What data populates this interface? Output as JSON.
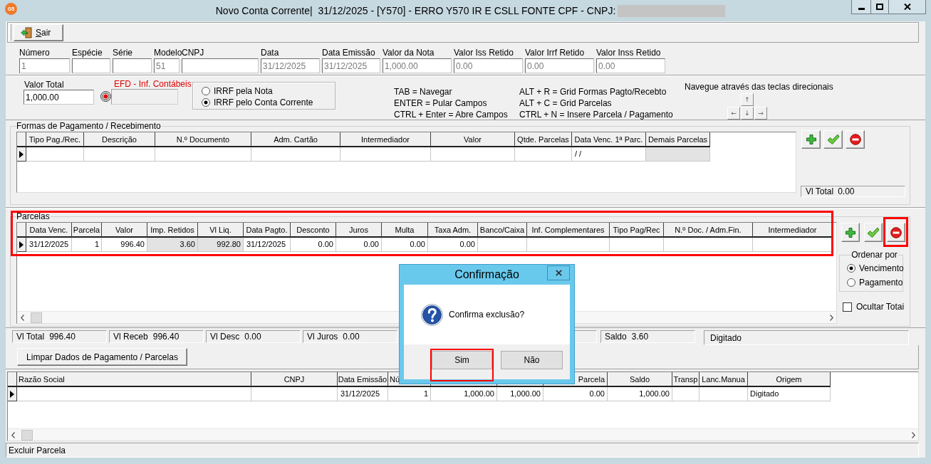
{
  "window": {
    "icon_label": "G5",
    "title": "Novo Conta Corrente|  31/12/2025 - [Y570] - ERRO Y570 IR E CSLL FONTE CPF - CNPJ:",
    "title_redacted": true
  },
  "toolbar": {
    "buttons": [
      {
        "label": "Sair"
      }
    ]
  },
  "header_fields": [
    {
      "label": "Número",
      "value": "1",
      "disabled": true
    },
    {
      "label": "Espécie"
    },
    {
      "label": "Série"
    },
    {
      "label": "Modelo",
      "value": "51",
      "disabled": true
    },
    {
      "label": "CNPJ"
    },
    {
      "label": "Data",
      "value": "31/12/2025",
      "disabled": true
    },
    {
      "label": "Data Emissão",
      "value": "31/12/2025",
      "disabled": true
    },
    {
      "label": "Valor da Nota",
      "value": "1,000.00",
      "disabled": true
    },
    {
      "label": "Valor Iss Retido",
      "value": "0.00",
      "disabled": true
    },
    {
      "label": "Valor Irrf Retido",
      "value": "0.00",
      "disabled": true
    },
    {
      "label": "Valor Inss Retido",
      "value": "0.00",
      "disabled": true
    }
  ],
  "valor_total": {
    "label": "Valor Total",
    "value": "1,000.00"
  },
  "efd": {
    "label": "EFD - Inf. Contábeis"
  },
  "irrf_options": [
    {
      "label": "IRRF pela Nota",
      "selected": false
    },
    {
      "label": "IRRF pelo Conta Corrente",
      "selected": true
    }
  ],
  "shortcuts": [
    {
      "lines": [
        "TAB = Navegar",
        "ENTER = Pular Campos",
        "CTRL + Enter = Abre Campos"
      ]
    },
    {
      "lines": [
        "ALT + R = Grid Formas Pagto/Recebto",
        "ALT + C = Grid Parcelas",
        "CTRL + N = Insere Parcela / Pagamento"
      ]
    }
  ],
  "navigation": {
    "hint": "Navegue através das teclas direcionais",
    "keys": [
      "↑",
      "←",
      "↓",
      "→"
    ]
  },
  "payment_forms": {
    "legend": "Formas de Pagamento / Recebimento",
    "columns": [
      {
        "label": "Tipo Pag./Rec.",
        "kind": "text",
        "shaded": false
      },
      {
        "label": "Descrição",
        "kind": "text",
        "shaded": false
      },
      {
        "label": "N.º Documento",
        "kind": "text",
        "shaded": false
      },
      {
        "label": "Adm. Cartão",
        "kind": "text",
        "shaded": false
      },
      {
        "label": "Intermediador",
        "kind": "text",
        "shaded": false
      },
      {
        "label": "Valor",
        "kind": "number",
        "shaded": false
      },
      {
        "label": "Qtde. Parcelas",
        "kind": "number",
        "shaded": false
      },
      {
        "label": "Data Venc. 1ª Parc.",
        "kind": "date",
        "shaded": false
      },
      {
        "label": "Demais Parcelas",
        "kind": "text",
        "shaded": true
      }
    ],
    "rows": [
      {
        "cells": [
          null,
          null,
          null,
          null,
          null,
          null,
          null,
          "/ /",
          null
        ]
      }
    ],
    "buttons": [
      {
        "kind": "add"
      },
      {
        "kind": "confirm"
      },
      {
        "kind": "remove"
      }
    ],
    "total": {
      "label": "Vl Total",
      "value": "0.00"
    }
  },
  "parcelas": {
    "legend": "Parcelas",
    "highlighted": true,
    "columns": [
      {
        "label": "Data Venc.",
        "kind": "date",
        "shaded": false
      },
      {
        "label": "Parcela",
        "kind": "number",
        "shaded": false
      },
      {
        "label": "Valor",
        "kind": "number",
        "shaded": false
      },
      {
        "label": "Imp. Retidos",
        "kind": "number",
        "shaded": true
      },
      {
        "label": "Vl Liq.",
        "kind": "number",
        "shaded": true
      },
      {
        "label": "Data Pagto.",
        "kind": "date",
        "shaded": false
      },
      {
        "label": "Desconto",
        "kind": "number",
        "shaded": false
      },
      {
        "label": "Juros",
        "kind": "number",
        "shaded": false
      },
      {
        "label": "Multa",
        "kind": "number",
        "shaded": false
      },
      {
        "label": "Taxa Adm.",
        "kind": "number",
        "shaded": false
      },
      {
        "label": "Banco/Caixa",
        "kind": "text",
        "shaded": false
      },
      {
        "label": "Inf. Complementares",
        "kind": "text",
        "shaded": false
      },
      {
        "label": "Tipo Pag/Rec",
        "kind": "text",
        "shaded": false
      },
      {
        "label": "N.º Doc. / Adm.Fin.",
        "kind": "text",
        "shaded": false
      },
      {
        "label": "Intermediador",
        "kind": "text",
        "shaded": false
      }
    ],
    "rows": [
      {
        "cells": [
          "31/12/2025",
          "1",
          "996.40",
          "3.60",
          "992.80",
          "31/12/2025",
          "0.00",
          "0.00",
          "0.00",
          "0.00",
          null,
          null,
          null,
          null,
          null
        ]
      }
    ],
    "buttons": [
      {
        "kind": "add"
      },
      {
        "kind": "confirm"
      },
      {
        "kind": "remove",
        "highlighted": true
      }
    ],
    "sort": {
      "legend": "Ordenar por",
      "options": [
        {
          "label": "Vencimento",
          "selected": true
        },
        {
          "label": "Pagamento",
          "selected": false
        }
      ]
    },
    "hide_totals": {
      "label": "Ocultar Totai",
      "checked": false
    }
  },
  "totals": [
    {
      "kind": "amount",
      "label": "Vl Total",
      "value": "996.40"
    },
    {
      "kind": "amount",
      "label": "Vl Receb",
      "value": "996.40"
    },
    {
      "kind": "amount",
      "label": "Vl Desc",
      "value": "0.00"
    },
    {
      "kind": "amount",
      "label": "Vl Juros",
      "value": "0.00"
    },
    {
      "kind": "amount",
      "label": "Saldo",
      "value": "3.60"
    },
    {
      "kind": "status",
      "value": "Digitado"
    }
  ],
  "actions": {
    "clear_button": "Limpar Dados de Pagamento / Parcelas"
  },
  "documents": {
    "columns": [
      {
        "label": "Razão Social",
        "kind": "text"
      },
      {
        "label": "CNPJ",
        "kind": "text"
      },
      {
        "label": "Data Emissão",
        "kind": "date"
      },
      {
        "label": "Nú",
        "kind": "number"
      },
      {
        "kind": "number"
      },
      {
        "kind": "number"
      },
      {
        "label": "Parcela",
        "kind": "number"
      },
      {
        "label": "Saldo",
        "kind": "number"
      },
      {
        "label": "Transp",
        "kind": "text"
      },
      {
        "label": "Lanc.Manua",
        "kind": "text"
      },
      {
        "label": "Origem",
        "kind": "text"
      }
    ],
    "rows": [
      {
        "cells": [
          null,
          null,
          "31/12/2025",
          "1",
          "1,000.00",
          "1,000.00",
          "0.00",
          "1,000.00",
          null,
          null,
          "Digitado"
        ]
      }
    ]
  },
  "status_bar": {
    "text": "Excluir Parcela"
  },
  "dialog": {
    "title": "Confirmação",
    "message": "Confirma exclusão?",
    "buttons": [
      {
        "label": "Sim",
        "highlighted": true
      },
      {
        "label": "Não"
      }
    ]
  }
}
